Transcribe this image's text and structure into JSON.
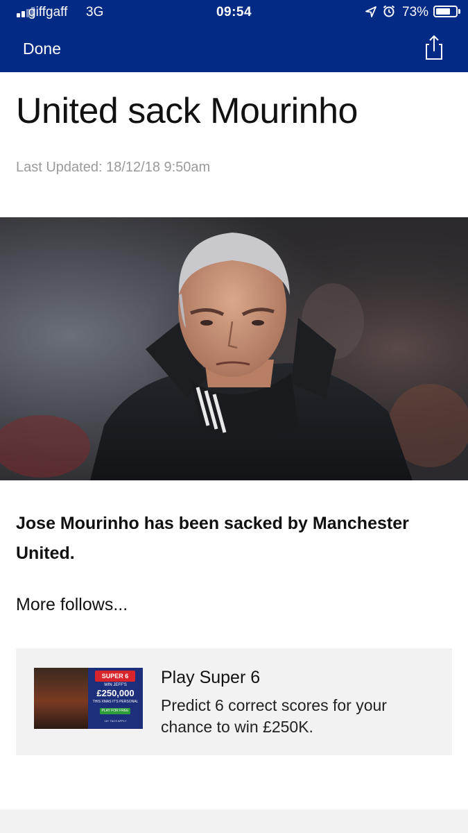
{
  "status_bar": {
    "carrier": "giffgaff",
    "network": "3G",
    "time": "09:54",
    "battery": "73%",
    "battery_level": 0.73,
    "signal_bars": 4,
    "signal_strength": 2,
    "icons": [
      "location-arrow-icon",
      "alarm-clock-icon",
      "battery-icon"
    ]
  },
  "nav": {
    "done_label": "Done",
    "share_icon": "share-icon",
    "background": "#032b86"
  },
  "article": {
    "headline": "United sack Mourinho",
    "last_updated": "Last Updated: 18/12/18 9:50am",
    "image_alt": "Jose Mourinho",
    "lead": "Jose Mourinho has been sacked by Manchester United.",
    "more": "More follows..."
  },
  "promo": {
    "title": "Play Super 6",
    "description": "Predict 6 correct scores for your chance to win £250K.",
    "thumbnail": {
      "logo": "SUPER 6",
      "win_text": "WIN JEFF'S",
      "amount": "£250,000",
      "tagline": "THIS XMAS IT'S PERSONAL",
      "button": "PLAY FOR FREE",
      "terms": "18+ T&CS APPLY"
    }
  }
}
